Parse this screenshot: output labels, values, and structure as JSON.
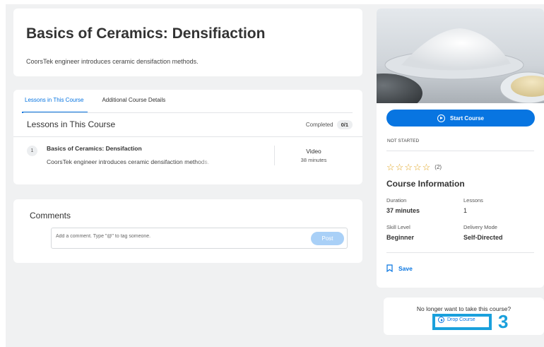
{
  "course": {
    "title": "Basics of Ceramics: Densifiaction",
    "subtitle": "CoorsTek engineer introduces ceramic densifaction methods."
  },
  "tabs": [
    {
      "label": "Lessons in This Course",
      "active": true
    },
    {
      "label": "Additional Course Details",
      "active": false
    }
  ],
  "lessons_section": {
    "header": "Lessons in This Course",
    "completed_label": "Completed",
    "completed_count": "0/1"
  },
  "lessons": [
    {
      "number": "1",
      "title": "Basics of Ceramics: Densifaction",
      "description": "CoorsTek engineer introduces ceramic densifaction methods.",
      "type": "Video",
      "duration": "38 minutes"
    }
  ],
  "comments": {
    "header": "Comments",
    "placeholder": "Add a comment. Type \"@\" to tag someone.",
    "post_label": "Post"
  },
  "sidebar": {
    "start_label": "Start Course",
    "status": "NOT STARTED",
    "rating_stars": 5,
    "rating_count": "(2)",
    "info_title": "Course Information",
    "info": {
      "duration_label": "Duration",
      "duration_value": "37 minutes",
      "lessons_label": "Lessons",
      "lessons_value": "1",
      "skill_label": "Skill Level",
      "skill_value": "Beginner",
      "delivery_label": "Delivery Mode",
      "delivery_value": "Self-Directed"
    },
    "save_label": "Save"
  },
  "drop": {
    "question": "No longer want to take this course?",
    "button_label": "Drop Course"
  },
  "annotation": {
    "number": "3",
    "color": "#1aa0dc"
  },
  "colors": {
    "accent": "#0875e1",
    "star": "#e0a21a",
    "background": "#f0f1f2"
  }
}
